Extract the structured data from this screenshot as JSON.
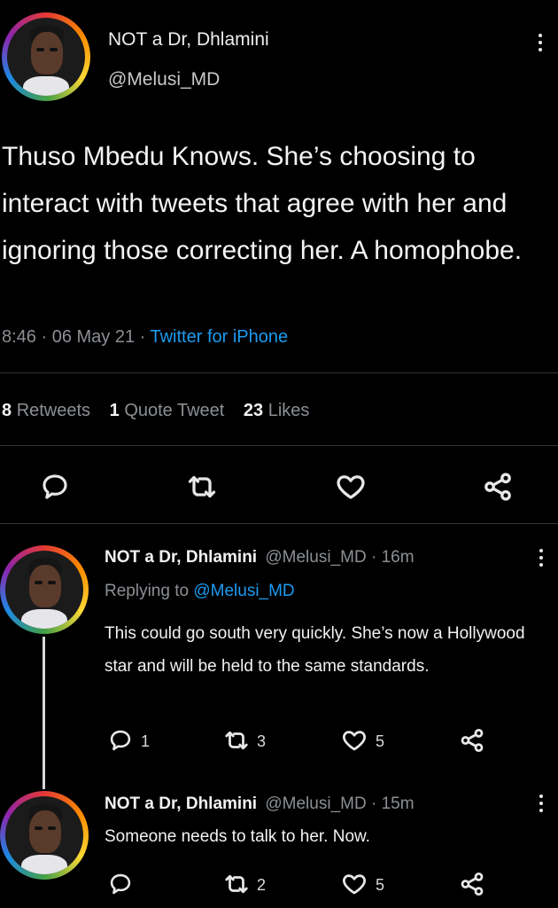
{
  "main_tweet": {
    "display_name": "NOT a Dr, Dhlamini",
    "handle": "@Melusi_MD",
    "text": "Thuso Mbedu Knows. She’s choosing to interact with tweets that agree with her and ignoring those correcting her. A homophobe.",
    "time": "8:46 · 06 May 21 · ",
    "source": "Twitter for iPhone",
    "retweets_count": "8",
    "retweets_label": "Retweets",
    "quotes_count": "1",
    "quotes_label": "Quote Tweet",
    "likes_count": "23",
    "likes_label": "Likes"
  },
  "replies": [
    {
      "display_name": "NOT a Dr, Dhlamini",
      "handle_time": "@Melusi_MD · 16m",
      "replying_prefix": "Replying to",
      "replying_handle": "@Melusi_MD",
      "text": "This could go south very quickly. She’s now a Hollywood star and will be held to the same standards.",
      "reply_count": "1",
      "retweet_count": "3",
      "like_count": "5"
    },
    {
      "display_name": "NOT a Dr, Dhlamini",
      "handle_time": "@Melusi_MD · 15m",
      "text": "Someone needs to talk to her. Now.",
      "retweet_count": "2",
      "like_count": "5"
    }
  ],
  "icons": [
    "reply-icon",
    "retweet-icon",
    "like-icon",
    "share-icon",
    "more-icon"
  ],
  "colors": {
    "background": "#000000",
    "link": "#1d9bf0",
    "secondary_text": "#8b8f94"
  }
}
